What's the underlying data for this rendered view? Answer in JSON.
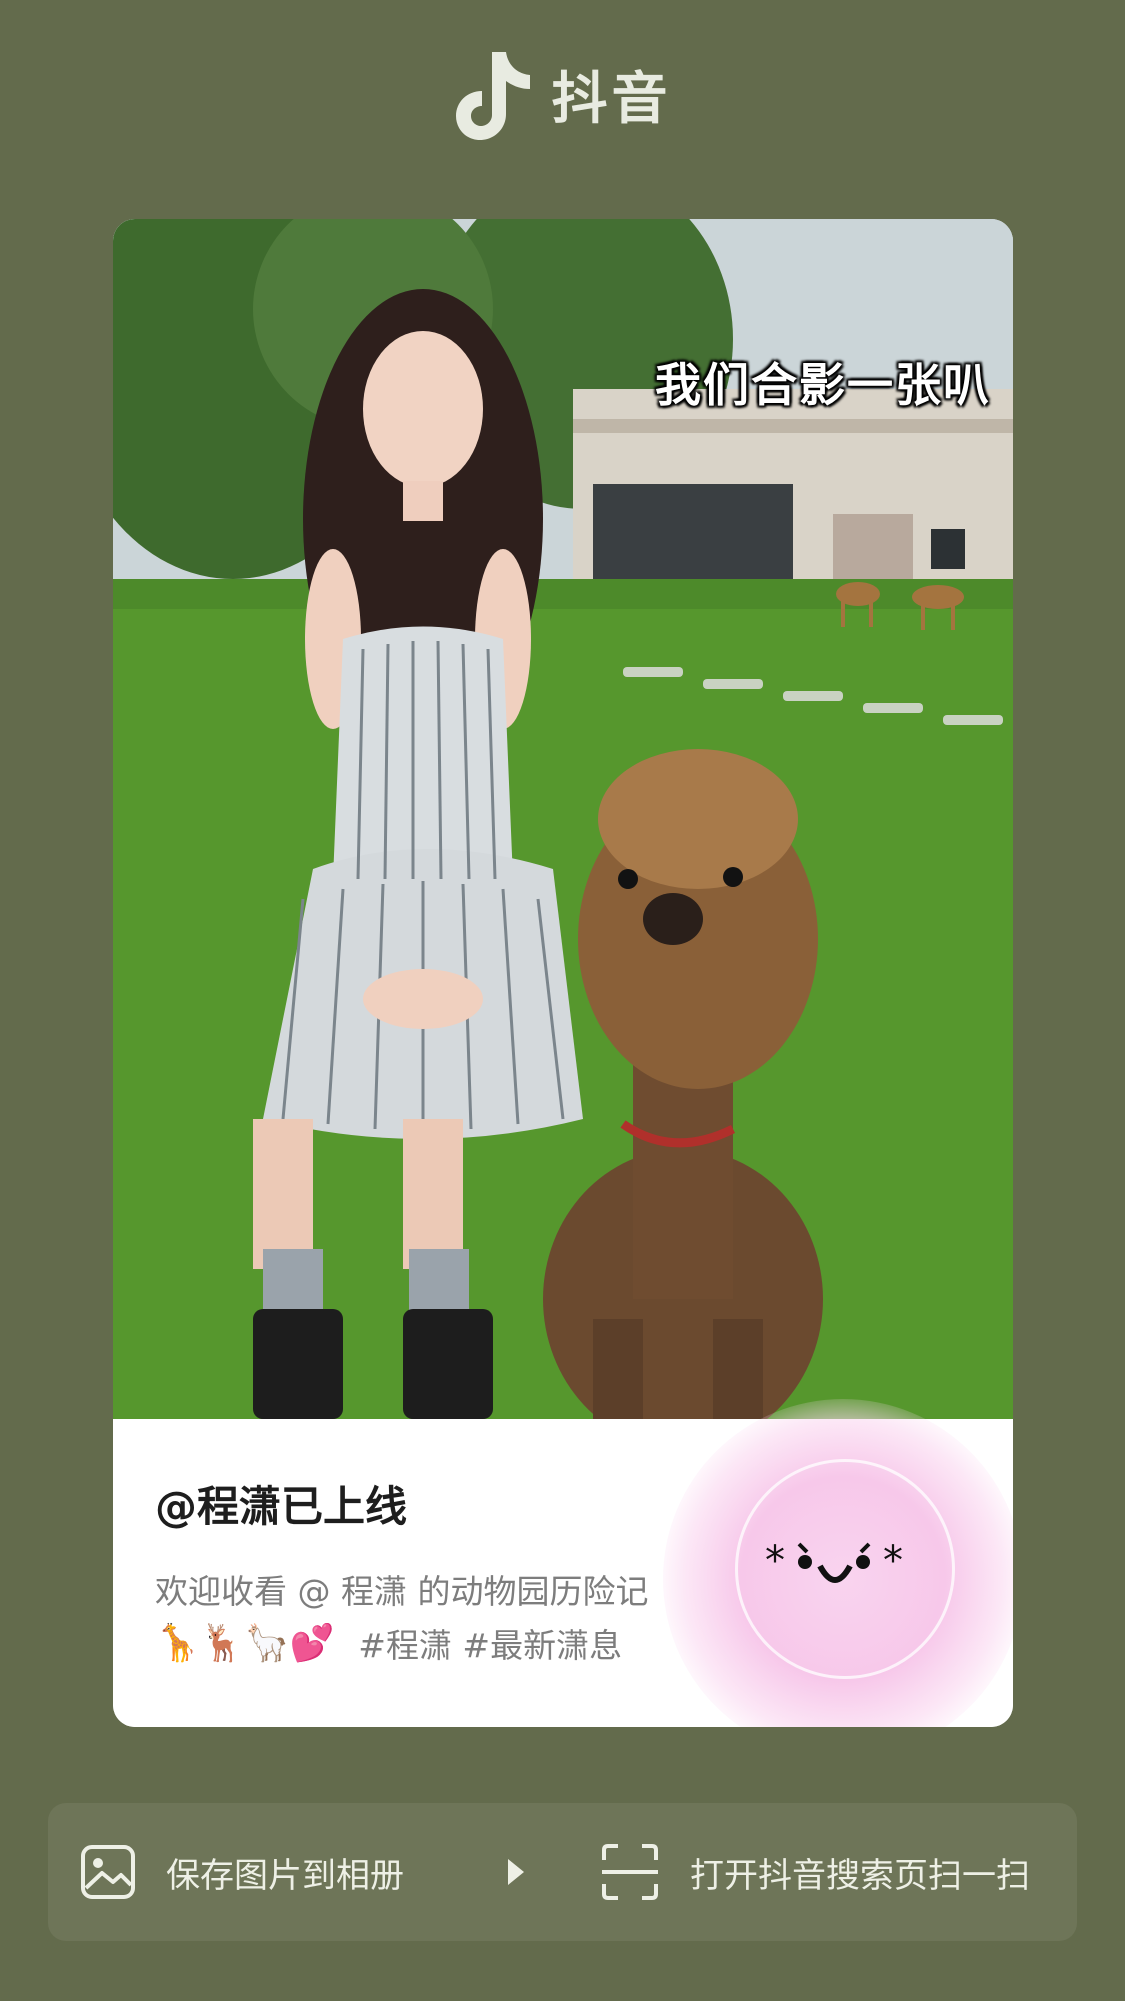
{
  "header": {
    "app_name": "抖音",
    "logo_icon": "tiktok-note-icon"
  },
  "post": {
    "image_caption": "我们合影一张叭",
    "author": "@程潇已上线",
    "description": "欢迎收看 @ 程潇  的动物园历险记",
    "emojis": "🦒🦌🦙💕",
    "hashtags": "#程潇 #最新潇息",
    "qr_face_text": "*`◡´*"
  },
  "toolbar": {
    "save_label": "保存图片到相册",
    "save_icon": "image-icon",
    "arrow_icon": "play-arrow-icon",
    "scan_label": "打开抖音搜索页扫一扫",
    "scan_icon": "scan-icon"
  },
  "colors": {
    "background": "#636b4c",
    "toolbar": "#6e7558",
    "card": "#ffffff",
    "qr_glow": "#f7c8ea"
  }
}
